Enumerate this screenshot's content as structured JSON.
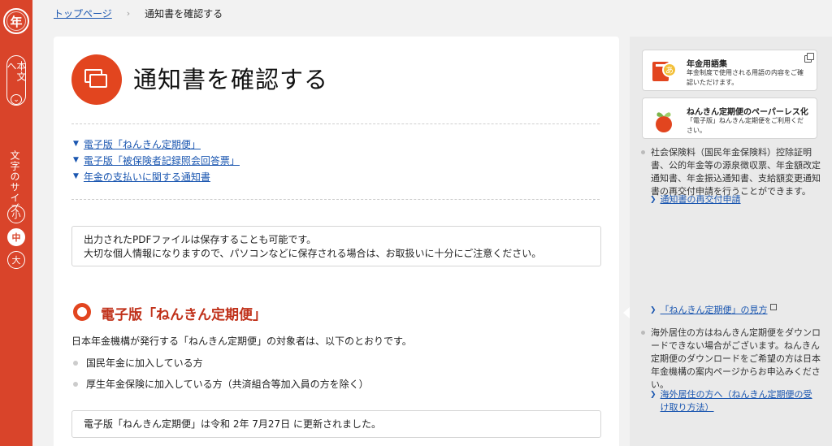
{
  "rail": {
    "logo": "年",
    "main_text": "本文へ",
    "font_size_label": "文字のサイズ",
    "sizes": [
      "小",
      "中",
      "大"
    ],
    "active_size": "中"
  },
  "breadcrumb": {
    "home": "トップページ",
    "separator": "›",
    "current": "通知書を確認する"
  },
  "main": {
    "title": "通知書を確認する",
    "toc": [
      "電子版「ねんきん定期便」",
      "電子版「被保険者記録照会回答票」",
      "年金の支払いに関する通知書"
    ],
    "notice1": [
      "出力されたPDFファイルは保存することも可能です。",
      "大切な個人情報になりますので、パソコンなどに保存される場合は、お取扱いに十分にご注意ください。"
    ],
    "section_title": "電子版「ねんきん定期便」",
    "section_intro": "日本年金機構が発行する「ねんきん定期便」の対象者は、以下のとおりです。",
    "bullets": [
      "国民年金に加入している方",
      "厚生年金保険に加入している方（共済組合等加入員の方を除く）"
    ],
    "notice2": "電子版「ねんきん定期便」は令和 2年 7月27日 に更新されました。"
  },
  "side": {
    "card1": {
      "title": "年金用語集",
      "desc": "年金制度で使用される用語の内容をご確認いただけます。"
    },
    "card2": {
      "title": "ねんきん定期便のペーパーレス化",
      "desc": "「電子版」ねんきん定期便をご利用ください。"
    },
    "text1": "社会保険料（国民年金保険料）控除証明書、公的年金等の源泉徴収票、年金額改定通知書、年金振込通知書、支給額変更通知書の再交付申請を行うことができます。",
    "link1": "通知書の再交付申請",
    "link2": "「ねんきん定期便」の見方",
    "text2": "海外居住の方はねんきん定期便をダウンロードできない場合がございます。ねんきん定期便のダウンロードをご希望の方は日本年金機構の案内ページからお申込みください。",
    "link3": "海外居住の方へ（ねんきん定期便の受け取り方法）"
  },
  "colors": {
    "accent": "#d9442a",
    "link": "#1a56b0",
    "section_title": "#c0311a"
  },
  "icons": [
    "documents-icon",
    "glossary-book-icon",
    "paperless-plant-icon",
    "external-link-icon",
    "chevron-down-icon"
  ]
}
